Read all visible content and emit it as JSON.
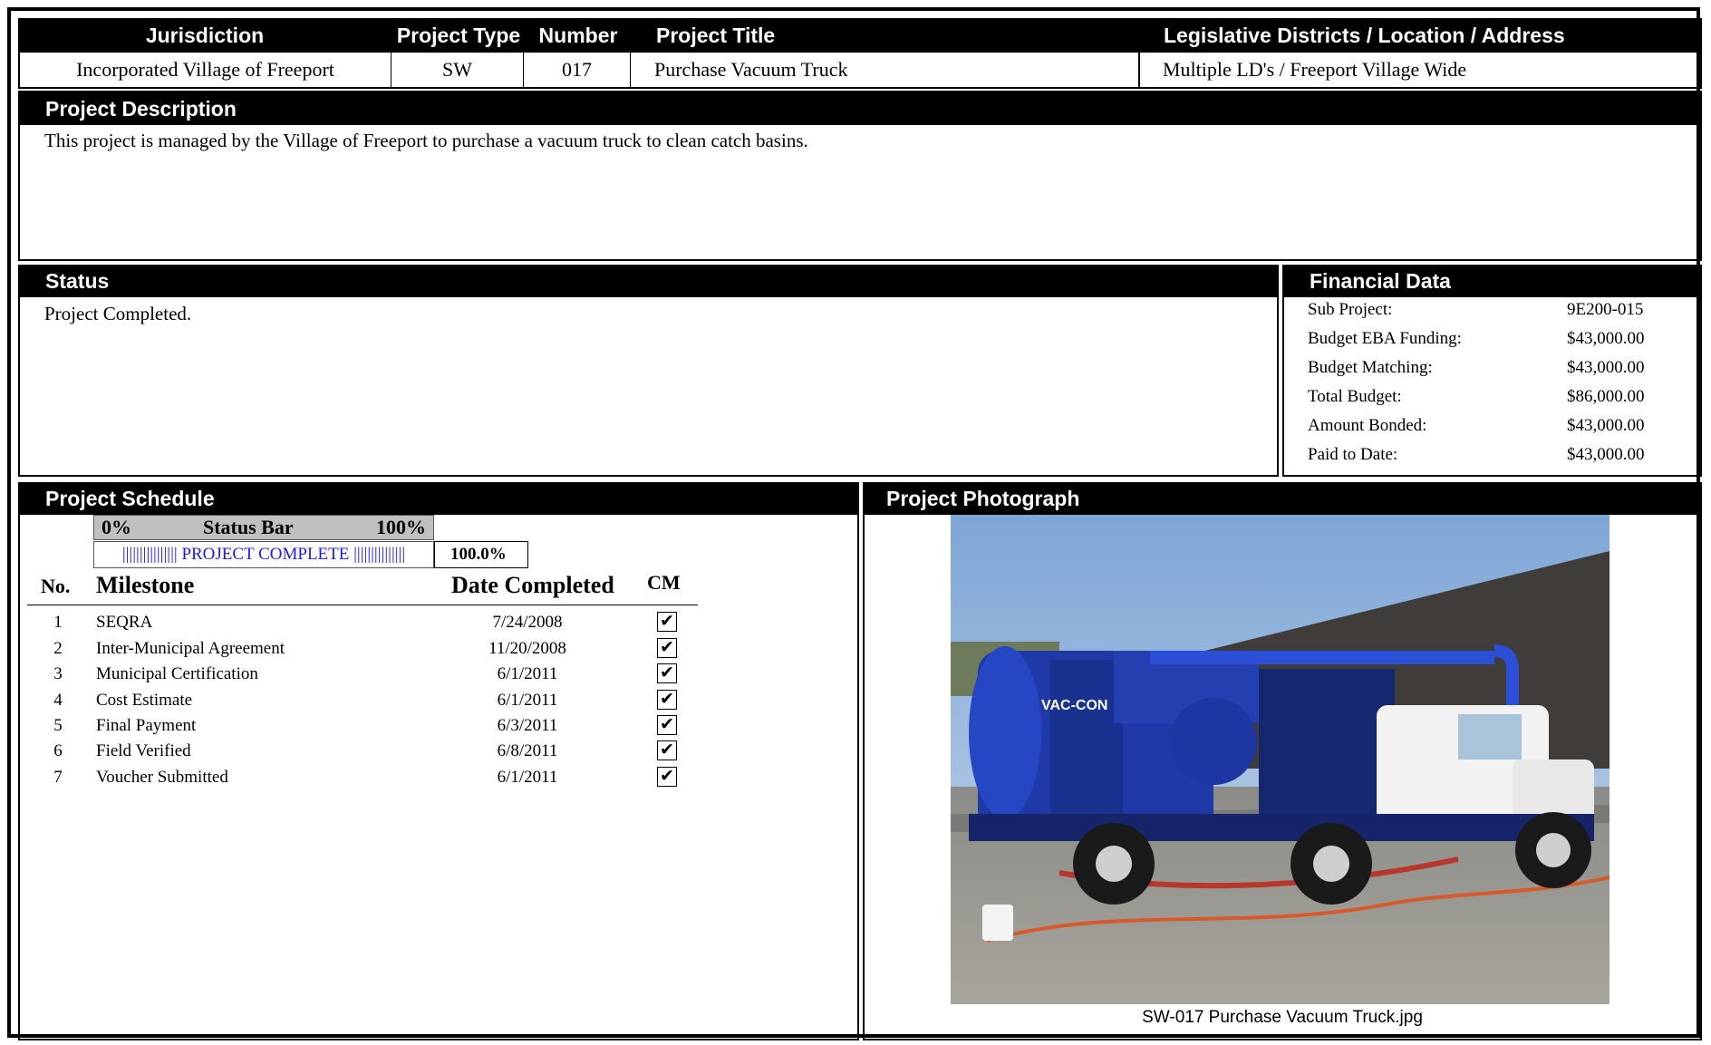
{
  "header": {
    "col_jurisdiction": "Jurisdiction",
    "col_project_type": "Project Type",
    "col_number": "Number",
    "col_project_title": "Project Title",
    "col_location": "Legislative Districts / Location / Address"
  },
  "project": {
    "jurisdiction": "Incorporated Village of Freeport",
    "project_type": "SW",
    "number": "017",
    "title": "Purchase Vacuum Truck",
    "location": "Multiple LD's / Freeport Village Wide"
  },
  "description": {
    "heading": "Project Description",
    "text": "This project is managed by the Village of Freeport to purchase a vacuum truck to clean catch basins."
  },
  "status": {
    "heading": "Status",
    "text": "Project Completed."
  },
  "financial": {
    "heading": "Financial Data",
    "rows": [
      {
        "label": "Sub Project:",
        "value": "9E200-015"
      },
      {
        "label": "Budget EBA Funding:",
        "value": "$43,000.00"
      },
      {
        "label": "Budget Matching:",
        "value": "$43,000.00"
      },
      {
        "label": "Total Budget:",
        "value": "$86,000.00"
      },
      {
        "label": "Amount Bonded:",
        "value": "$43,000.00"
      },
      {
        "label": "Paid to Date:",
        "value": "$43,000.00"
      }
    ]
  },
  "schedule": {
    "heading": "Project Schedule",
    "status_bar": {
      "left_label": "0%",
      "center_label": "Status Bar",
      "right_label": "100%",
      "bar_text": "|||||||||||||||| PROJECT COMPLETE |||||||||||||||",
      "percent_text": "100.0%",
      "progress_fraction": 1.0
    },
    "columns": {
      "no": "No.",
      "milestone": "Milestone",
      "date": "Date Completed",
      "cm": "CM"
    },
    "milestones": [
      {
        "no": "1",
        "name": "SEQRA",
        "date": "7/24/2008",
        "cm": "✔"
      },
      {
        "no": "2",
        "name": "Inter-Municipal Agreement",
        "date": "11/20/2008",
        "cm": "✔"
      },
      {
        "no": "3",
        "name": "Municipal Certification",
        "date": "6/1/2011",
        "cm": "✔"
      },
      {
        "no": "4",
        "name": "Cost Estimate",
        "date": "6/1/2011",
        "cm": "✔"
      },
      {
        "no": "5",
        "name": "Final Payment",
        "date": "6/3/2011",
        "cm": "✔"
      },
      {
        "no": "6",
        "name": "Field Verified",
        "date": "6/8/2011",
        "cm": "✔"
      },
      {
        "no": "7",
        "name": "Voucher Submitted",
        "date": "6/1/2011",
        "cm": "✔"
      }
    ]
  },
  "photograph": {
    "heading": "Project Photograph",
    "caption": "SW-017 Purchase Vacuum Truck.jpg",
    "brand_text": "VAC-CON"
  }
}
